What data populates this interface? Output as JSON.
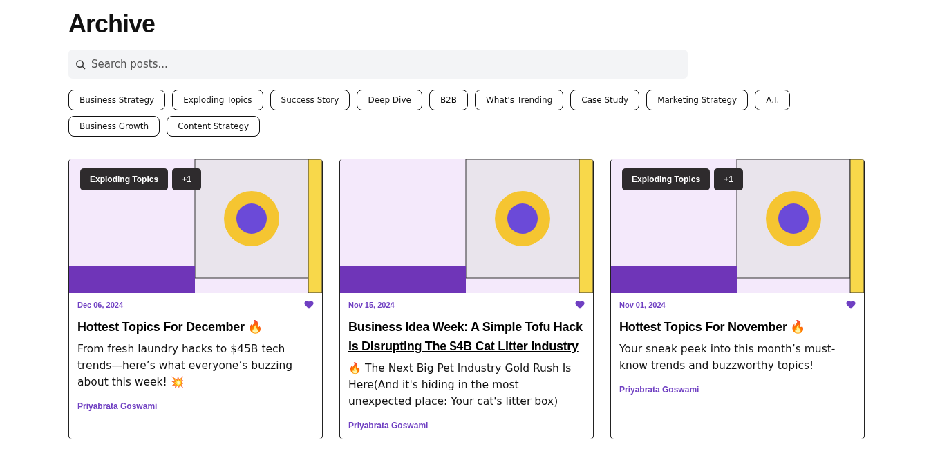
{
  "page_title": "Archive",
  "search": {
    "placeholder": "Search posts..."
  },
  "filters": [
    "Business Strategy",
    "Exploding Topics",
    "Success Story",
    "Deep Dive",
    "B2B",
    "What's Trending",
    "Case Study",
    "Marketing Strategy",
    "A.I.",
    "Business Growth",
    "Content Strategy"
  ],
  "posts": [
    {
      "tags": [
        "Exploding Topics",
        "+1"
      ],
      "date": "Dec 06, 2024",
      "title": "Hottest Topics For December 🔥",
      "hovered": false,
      "excerpt": "From fresh laundry hacks to $45B tech trends—here’s what everyone’s buzzing about this week! 💥",
      "author": "Priyabrata Goswami"
    },
    {
      "date": "Nov 15, 2024",
      "title": "Business Idea Week: A Simple Tofu Hack Is Disrupting The $4B Cat Litter Industry",
      "hovered": true,
      "excerpt": "🔥 The Next Big Pet Industry Gold Rush Is Here(And it's hiding in the most unexpected place: Your cat's litter box)",
      "author": "Priyabrata Goswami"
    },
    {
      "tags": [
        "Exploding Topics",
        "+1"
      ],
      "date": "Nov 01, 2024",
      "title": "Hottest Topics For November 🔥",
      "hovered": false,
      "excerpt": "Your sneak peek into this month’s must-know trends and buzzworthy topics!",
      "author": "Priyabrata Goswami"
    }
  ]
}
